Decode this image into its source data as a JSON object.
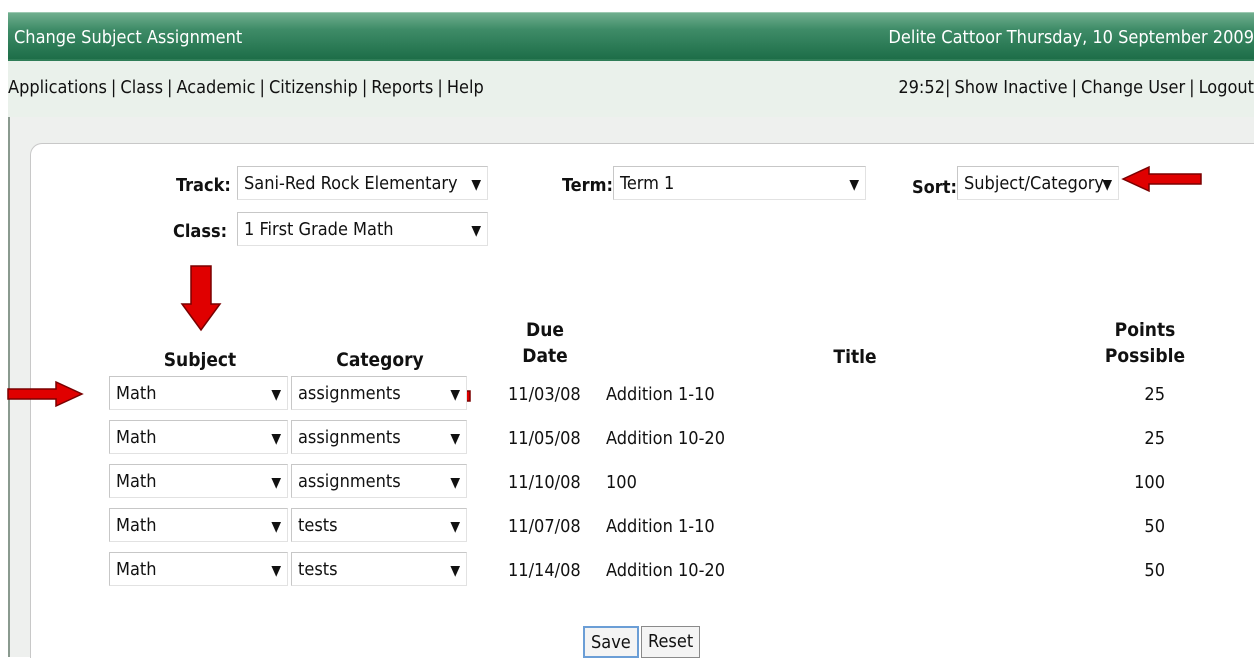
{
  "window": {
    "title": "Change Subject Assignment",
    "user_date": "Delite Cattoor  Thursday, 10 September 2009"
  },
  "menu": {
    "left": [
      "Applications",
      "Class",
      "Academic",
      "Citizenship",
      "Reports",
      "Help"
    ],
    "timer": "29:52",
    "right": [
      "Show Inactive",
      "Change User",
      "Logout"
    ]
  },
  "filters": {
    "track_label": "Track:",
    "track_value": "Sani-Red Rock Elementary",
    "term_label": "Term:",
    "term_value": "Term 1",
    "sort_label": "Sort:",
    "sort_value": "Subject/Category",
    "class_label": "Class:",
    "class_value": "1 First Grade Math"
  },
  "table": {
    "headers": {
      "subject": "Subject",
      "category": "Category",
      "due_date_1": "Due",
      "due_date_2": "Date",
      "title": "Title",
      "points_1": "Points",
      "points_2": "Possible"
    },
    "rows": [
      {
        "subject": "Math",
        "category": "assignments",
        "due": "11/03/08",
        "title": "Addition 1-10",
        "points": "25"
      },
      {
        "subject": "Math",
        "category": "assignments",
        "due": "11/05/08",
        "title": "Addition 10-20",
        "points": "25"
      },
      {
        "subject": "Math",
        "category": "assignments",
        "due": "11/10/08",
        "title": "100",
        "points": "100"
      },
      {
        "subject": "Math",
        "category": "tests",
        "due": "11/07/08",
        "title": "Addition 1-10",
        "points": "50"
      },
      {
        "subject": "Math",
        "category": "tests",
        "due": "11/14/08",
        "title": "Addition 10-20",
        "points": "50"
      }
    ]
  },
  "buttons": {
    "save": "Save",
    "reset": "Reset"
  },
  "icons": {
    "dropdown": "chevron-down-icon",
    "annotation_arrow": "red-arrow-icon"
  },
  "colors": {
    "header_green": "#1d6e48",
    "arrow_red": "#e00000"
  }
}
